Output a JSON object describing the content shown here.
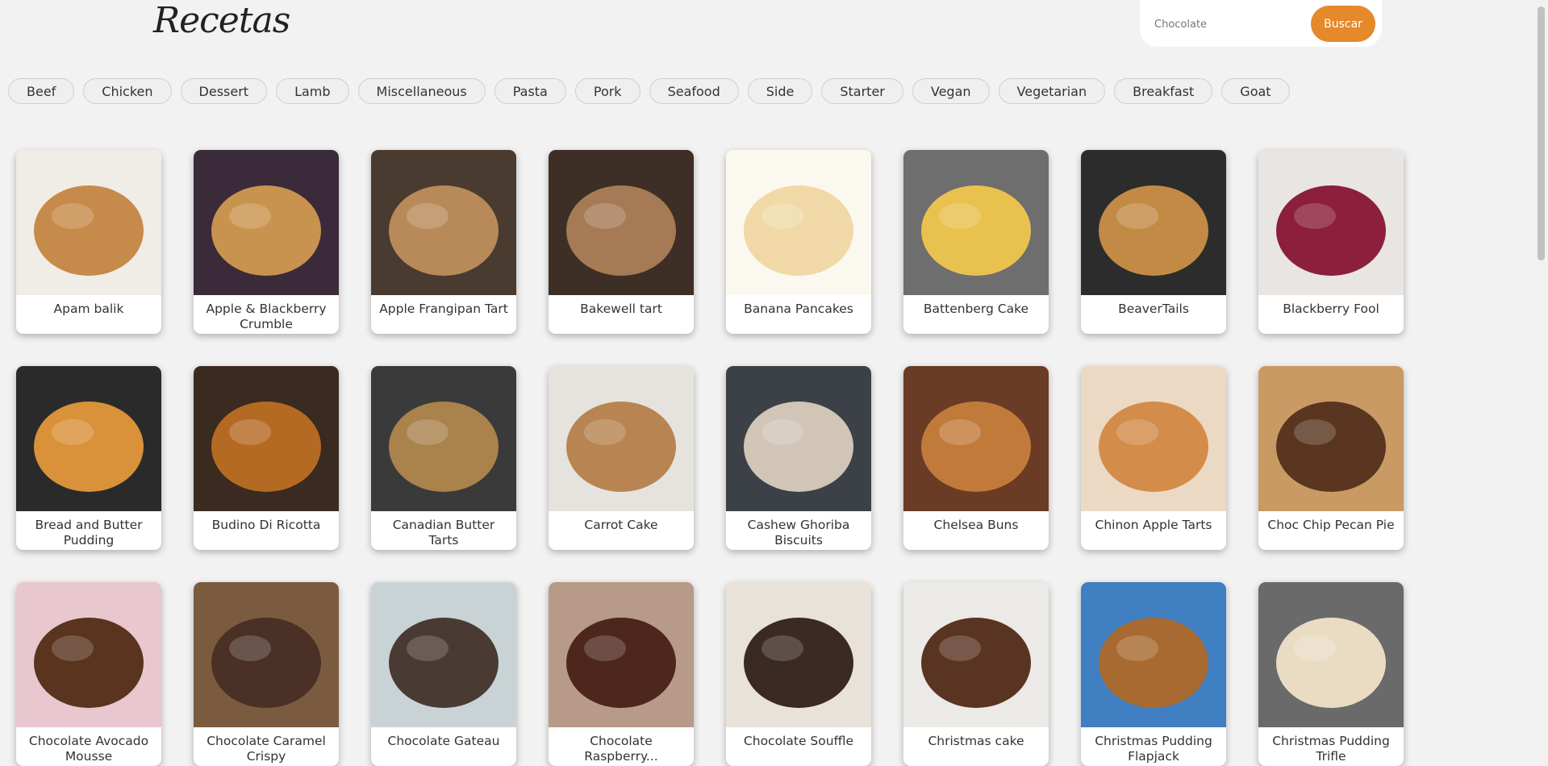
{
  "header": {
    "logo": "Recetas",
    "search": {
      "value": "",
      "placeholder": "Chocolate",
      "button_label": "Buscar"
    }
  },
  "categories": [
    "Beef",
    "Chicken",
    "Dessert",
    "Lamb",
    "Miscellaneous",
    "Pasta",
    "Pork",
    "Seafood",
    "Side",
    "Starter",
    "Vegan",
    "Vegetarian",
    "Breakfast",
    "Goat"
  ],
  "recipes": [
    {
      "title": "Apam balik",
      "colors": [
        "#c68a4a",
        "#f0ece6"
      ]
    },
    {
      "title": "Apple & Blackberry Crumble",
      "colors": [
        "#c8934e",
        "#3b2a3a"
      ]
    },
    {
      "title": "Apple Frangipan Tart",
      "colors": [
        "#b88a5a",
        "#4a3b30"
      ]
    },
    {
      "title": "Bakewell tart",
      "colors": [
        "#a57a55",
        "#3d2f26"
      ]
    },
    {
      "title": "Banana Pancakes",
      "colors": [
        "#f0d9a6",
        "#fbf8ef"
      ]
    },
    {
      "title": "Battenberg Cake",
      "colors": [
        "#e9c14e",
        "#6e6e6e"
      ]
    },
    {
      "title": "BeaverTails",
      "colors": [
        "#c38a45",
        "#2c2c2c"
      ]
    },
    {
      "title": "Blackberry Fool",
      "colors": [
        "#8b1f3c",
        "#e9e5e3"
      ]
    },
    {
      "title": "Bread and Butter Pudding",
      "colors": [
        "#d9913a",
        "#2a2a2a"
      ]
    },
    {
      "title": "Budino Di Ricotta",
      "colors": [
        "#b56a24",
        "#3a2a20"
      ]
    },
    {
      "title": "Canadian Butter Tarts",
      "colors": [
        "#a9824c",
        "#3a3a3a"
      ]
    },
    {
      "title": "Carrot Cake",
      "colors": [
        "#b88552",
        "#e6e3de"
      ]
    },
    {
      "title": "Cashew Ghoriba Biscuits",
      "colors": [
        "#d1c5b8",
        "#3c4147"
      ]
    },
    {
      "title": "Chelsea Buns",
      "colors": [
        "#c27a3b",
        "#6a3b25"
      ]
    },
    {
      "title": "Chinon Apple Tarts",
      "colors": [
        "#d48c4a",
        "#ecd9c4"
      ]
    },
    {
      "title": "Choc Chip Pecan Pie",
      "colors": [
        "#5a3520",
        "#c99a63"
      ]
    },
    {
      "title": "Chocolate Avocado Mousse",
      "colors": [
        "#5a341f",
        "#e8c7cf"
      ]
    },
    {
      "title": "Chocolate Caramel Crispy",
      "colors": [
        "#4a3025",
        "#7b5b3f"
      ]
    },
    {
      "title": "Chocolate Gateau",
      "colors": [
        "#4a3a34",
        "#c9d3d6"
      ]
    },
    {
      "title": "Chocolate Raspberry...",
      "colors": [
        "#4d261c",
        "#b79a88"
      ]
    },
    {
      "title": "Chocolate Souffle",
      "colors": [
        "#3a2a23",
        "#e9e2da"
      ]
    },
    {
      "title": "Christmas cake",
      "colors": [
        "#5a3423",
        "#eceae6"
      ]
    },
    {
      "title": "Christmas Pudding Flapjack",
      "colors": [
        "#a86a30",
        "#3f7fc2"
      ]
    },
    {
      "title": "Christmas Pudding Trifle",
      "colors": [
        "#e9dcc3",
        "#6a6a6a"
      ]
    }
  ]
}
